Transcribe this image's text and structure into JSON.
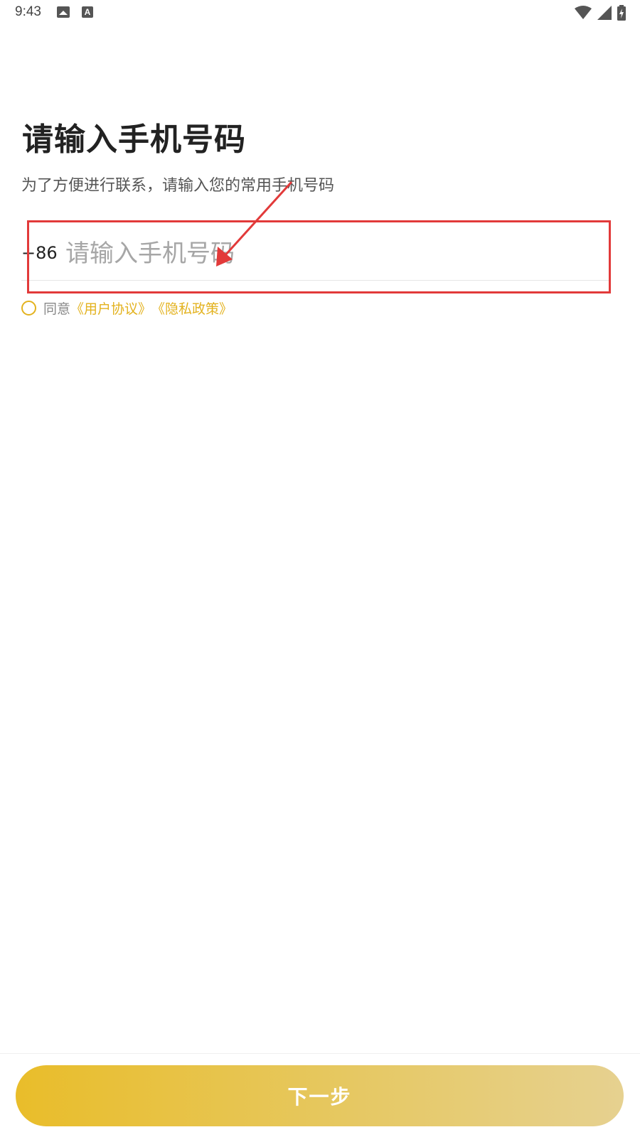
{
  "status_bar": {
    "time": "9:43",
    "icons": [
      "image-icon",
      "font-icon",
      "wifi-icon",
      "signal-icon",
      "battery-charging-icon"
    ],
    "font_icon_glyph": "A"
  },
  "main": {
    "title": "请输入手机号码",
    "subtitle": "为了方便进行联系，请输入您的常用手机号码",
    "phone": {
      "country_code": "+86",
      "value": "",
      "placeholder": "请输入手机号码"
    },
    "agreement": {
      "checked": false,
      "prefix": "同意",
      "user_agreement": "《用户协议》",
      "privacy_policy": "《隐私政策》"
    }
  },
  "footer": {
    "next_label": "下一步"
  },
  "colors": {
    "accent": "#e3b21e",
    "button_gradient_start": "#e9bd2a",
    "button_gradient_end": "#e6d190",
    "annotation": "#e23a3a"
  }
}
